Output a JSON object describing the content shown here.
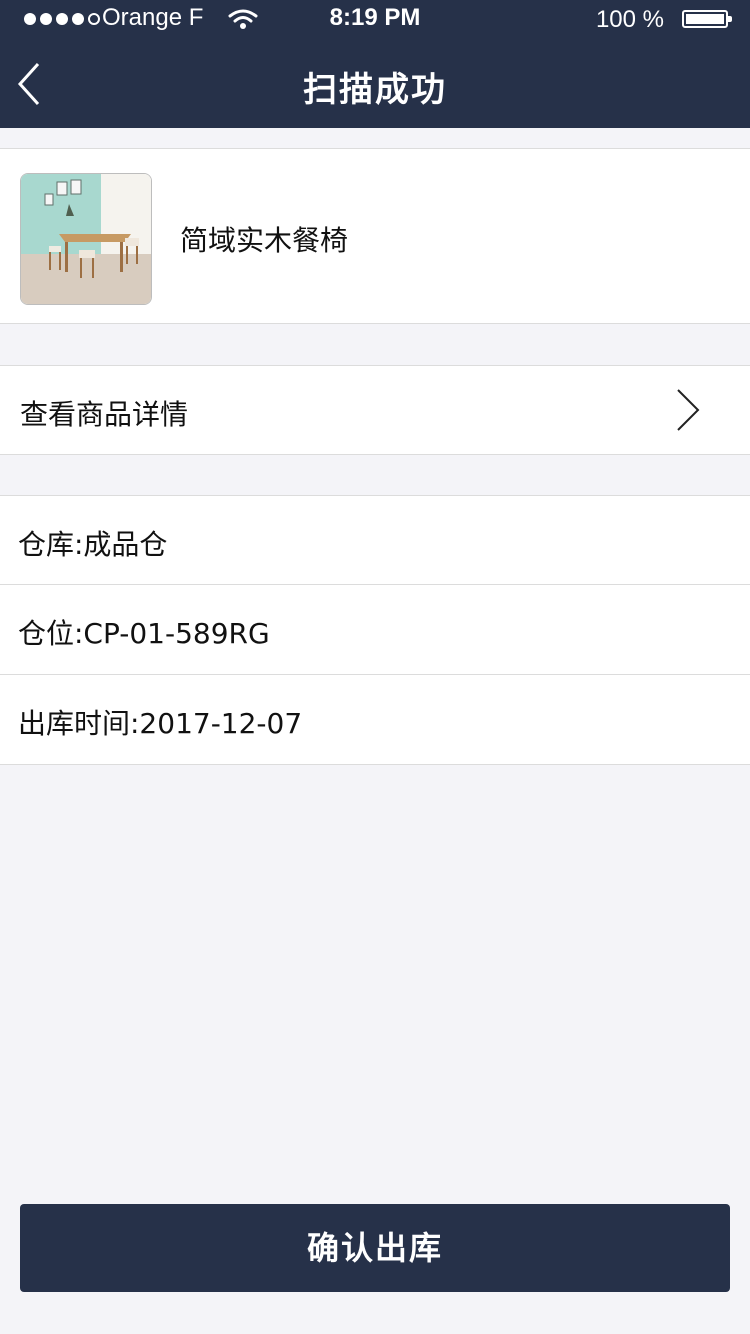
{
  "status_bar": {
    "carrier": "Orange F",
    "time": "8:19 PM",
    "battery": "100 %"
  },
  "nav": {
    "title": "扫描成功",
    "back_icon": "back-chevron"
  },
  "product": {
    "name": "简域实木餐椅",
    "image": "dining-set-photo"
  },
  "detail_link": {
    "label": "查看商品详情",
    "icon": "chevron-right"
  },
  "info": {
    "warehouse": "仓库:成品仓",
    "location": "仓位:CP-01-589RG",
    "outbound_time": "出库时间:2017-12-07"
  },
  "actions": {
    "confirm_label": "确认出库"
  },
  "colors": {
    "nav_bg": "#263149",
    "page_bg": "#f4f4f8",
    "card_bg": "#ffffff"
  }
}
